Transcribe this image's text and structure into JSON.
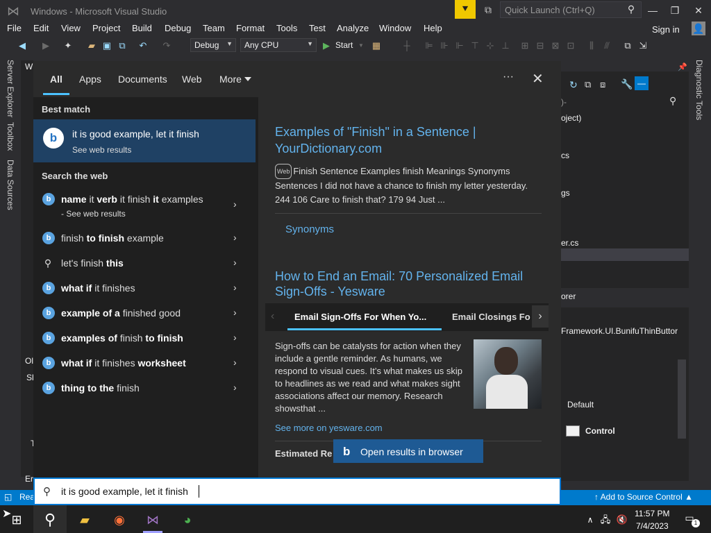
{
  "window": {
    "title": "Windows - Microsoft Visual Studio",
    "quick_launch_placeholder": "Quick Launch (Ctrl+Q)",
    "minimize": "—",
    "restore": "❐",
    "close": "✕"
  },
  "menu": {
    "items": [
      "File",
      "Edit",
      "View",
      "Project",
      "Build",
      "Debug",
      "Team",
      "Format",
      "Tools",
      "Test",
      "Analyze",
      "Window",
      "Help"
    ],
    "signin": "Sign in"
  },
  "toolbar": {
    "config": "Debug",
    "platform": "Any CPU",
    "start": "Start"
  },
  "side_tabs": {
    "server_explorer": "Server Explorer",
    "toolbox": "Toolbox",
    "data_sources": "Data Sources",
    "diagnostic_tools": "Diagnostic Tools"
  },
  "bg_fragments": {
    "project": "oject)",
    "cs1": "cs",
    "gs": "gs",
    "er_cs": "er.cs",
    "orer": "orer",
    "framework": "Framework.UI.BunifuThinButtor",
    "default": "Default",
    "control": "Control",
    "left_w": "W",
    "left_o": "Ol",
    "left_s": "Sl",
    "left_e": "Er",
    "left_t": "T"
  },
  "search": {
    "tabs": {
      "all": "All",
      "apps": "Apps",
      "documents": "Documents",
      "web": "Web",
      "more": "More"
    },
    "ellipsis": "···",
    "close": "✕",
    "best_match_header": "Best match",
    "best_match": {
      "title": "it is good example, let it finish",
      "subtitle": "See web results"
    },
    "search_web_header": "Search the web",
    "suggestions": [
      {
        "pre": "",
        "b1": "name",
        "m1": " it ",
        "b2": "verb",
        "m2": " it finish ",
        "b3": "it",
        "m3": " examples",
        "sub": "- See web results"
      },
      {
        "pre": "finish ",
        "b1": "to finish",
        "m1": " example"
      },
      {
        "pre": "let's finish ",
        "b1": "this",
        "m1": ""
      },
      {
        "pre": "",
        "b1": "what if",
        "m1": " it finishes"
      },
      {
        "pre": "",
        "b1": "example of a",
        "m1": " finished good"
      },
      {
        "pre": "",
        "b1": "examples of",
        "m1": " finish ",
        "b2": "to finish",
        "m2": ""
      },
      {
        "pre": "",
        "b1": "what if",
        "m1": " it finishes ",
        "b2": "worksheet",
        "m2": ""
      },
      {
        "pre": "",
        "b1": "thing to the",
        "m1": " finish"
      }
    ],
    "chevron": "›",
    "query": "it is good example, let it finish",
    "open_in_browser": "Open results in browser"
  },
  "results": {
    "r1": {
      "title_line1": "Examples of \"Finish\" in a Sentence |",
      "title_line2": "YourDictionary.com",
      "badge": "Web",
      "snippet": "Finish Sentence Examples finish Meanings Synonyms Sentences I did not have a chance to finish my letter yesterday. 244 106 Care to finish that? 179 94 Just ...",
      "synonyms": "Synonyms"
    },
    "r2": {
      "title_line1": "How to End an Email: 70 Personalized Email",
      "title_line2": "Sign-Offs - Yesware",
      "tab1": "Email Sign-Offs For When Yo...",
      "tab2": "Email Closings Fo",
      "snippet": "Sign-offs can be catalysts for action when they include a gentle reminder. As humans, we respond to visual cues. It’s what makes us skip to headlines as we read and what makes sight associations affect our memory. Research showsthat ...",
      "see_more": "See more on yesware.com",
      "estimated": "Estimated Re"
    }
  },
  "statusbar": {
    "ready": "Rea",
    "source_control": "Add to Source Control"
  },
  "taskbar": {
    "time": "11:57 PM",
    "date": "7/4/2023",
    "notif_count": "1"
  }
}
